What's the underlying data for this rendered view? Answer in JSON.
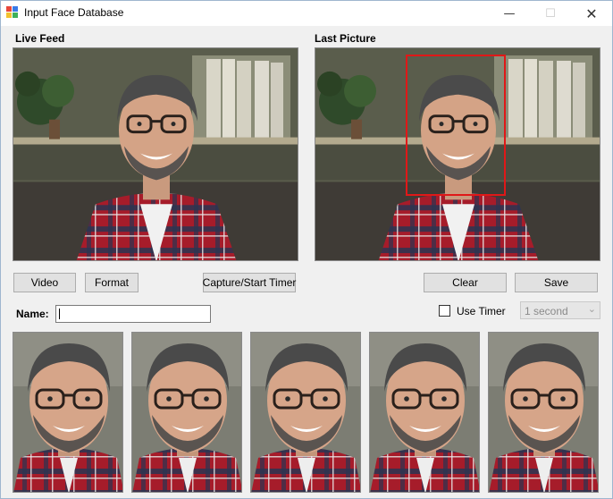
{
  "window": {
    "title": "Input Face Database",
    "controls": {
      "minimize": "—",
      "maximize": "☐",
      "close": "✕"
    }
  },
  "live_feed": {
    "label": "Live Feed"
  },
  "last_picture": {
    "label": "Last Picture",
    "face_box_color": "#e01818"
  },
  "buttons": {
    "video": "Video",
    "format": "Format",
    "capture": "Capture/Start Timer",
    "clear": "Clear",
    "save": "Save"
  },
  "name": {
    "label": "Name:",
    "value": ""
  },
  "timer": {
    "use_timer_label": "Use Timer",
    "checked": false,
    "interval_selected": "1 second",
    "interval_disabled": true
  },
  "thumbnails": {
    "count": 5
  },
  "colors": {
    "window_bg": "#f0f0f0",
    "button_bg": "#e1e1e1",
    "face_box": "#e01818"
  },
  "icons": {
    "app": "app-grid-icon",
    "dropdown": "chevron-down-icon"
  }
}
